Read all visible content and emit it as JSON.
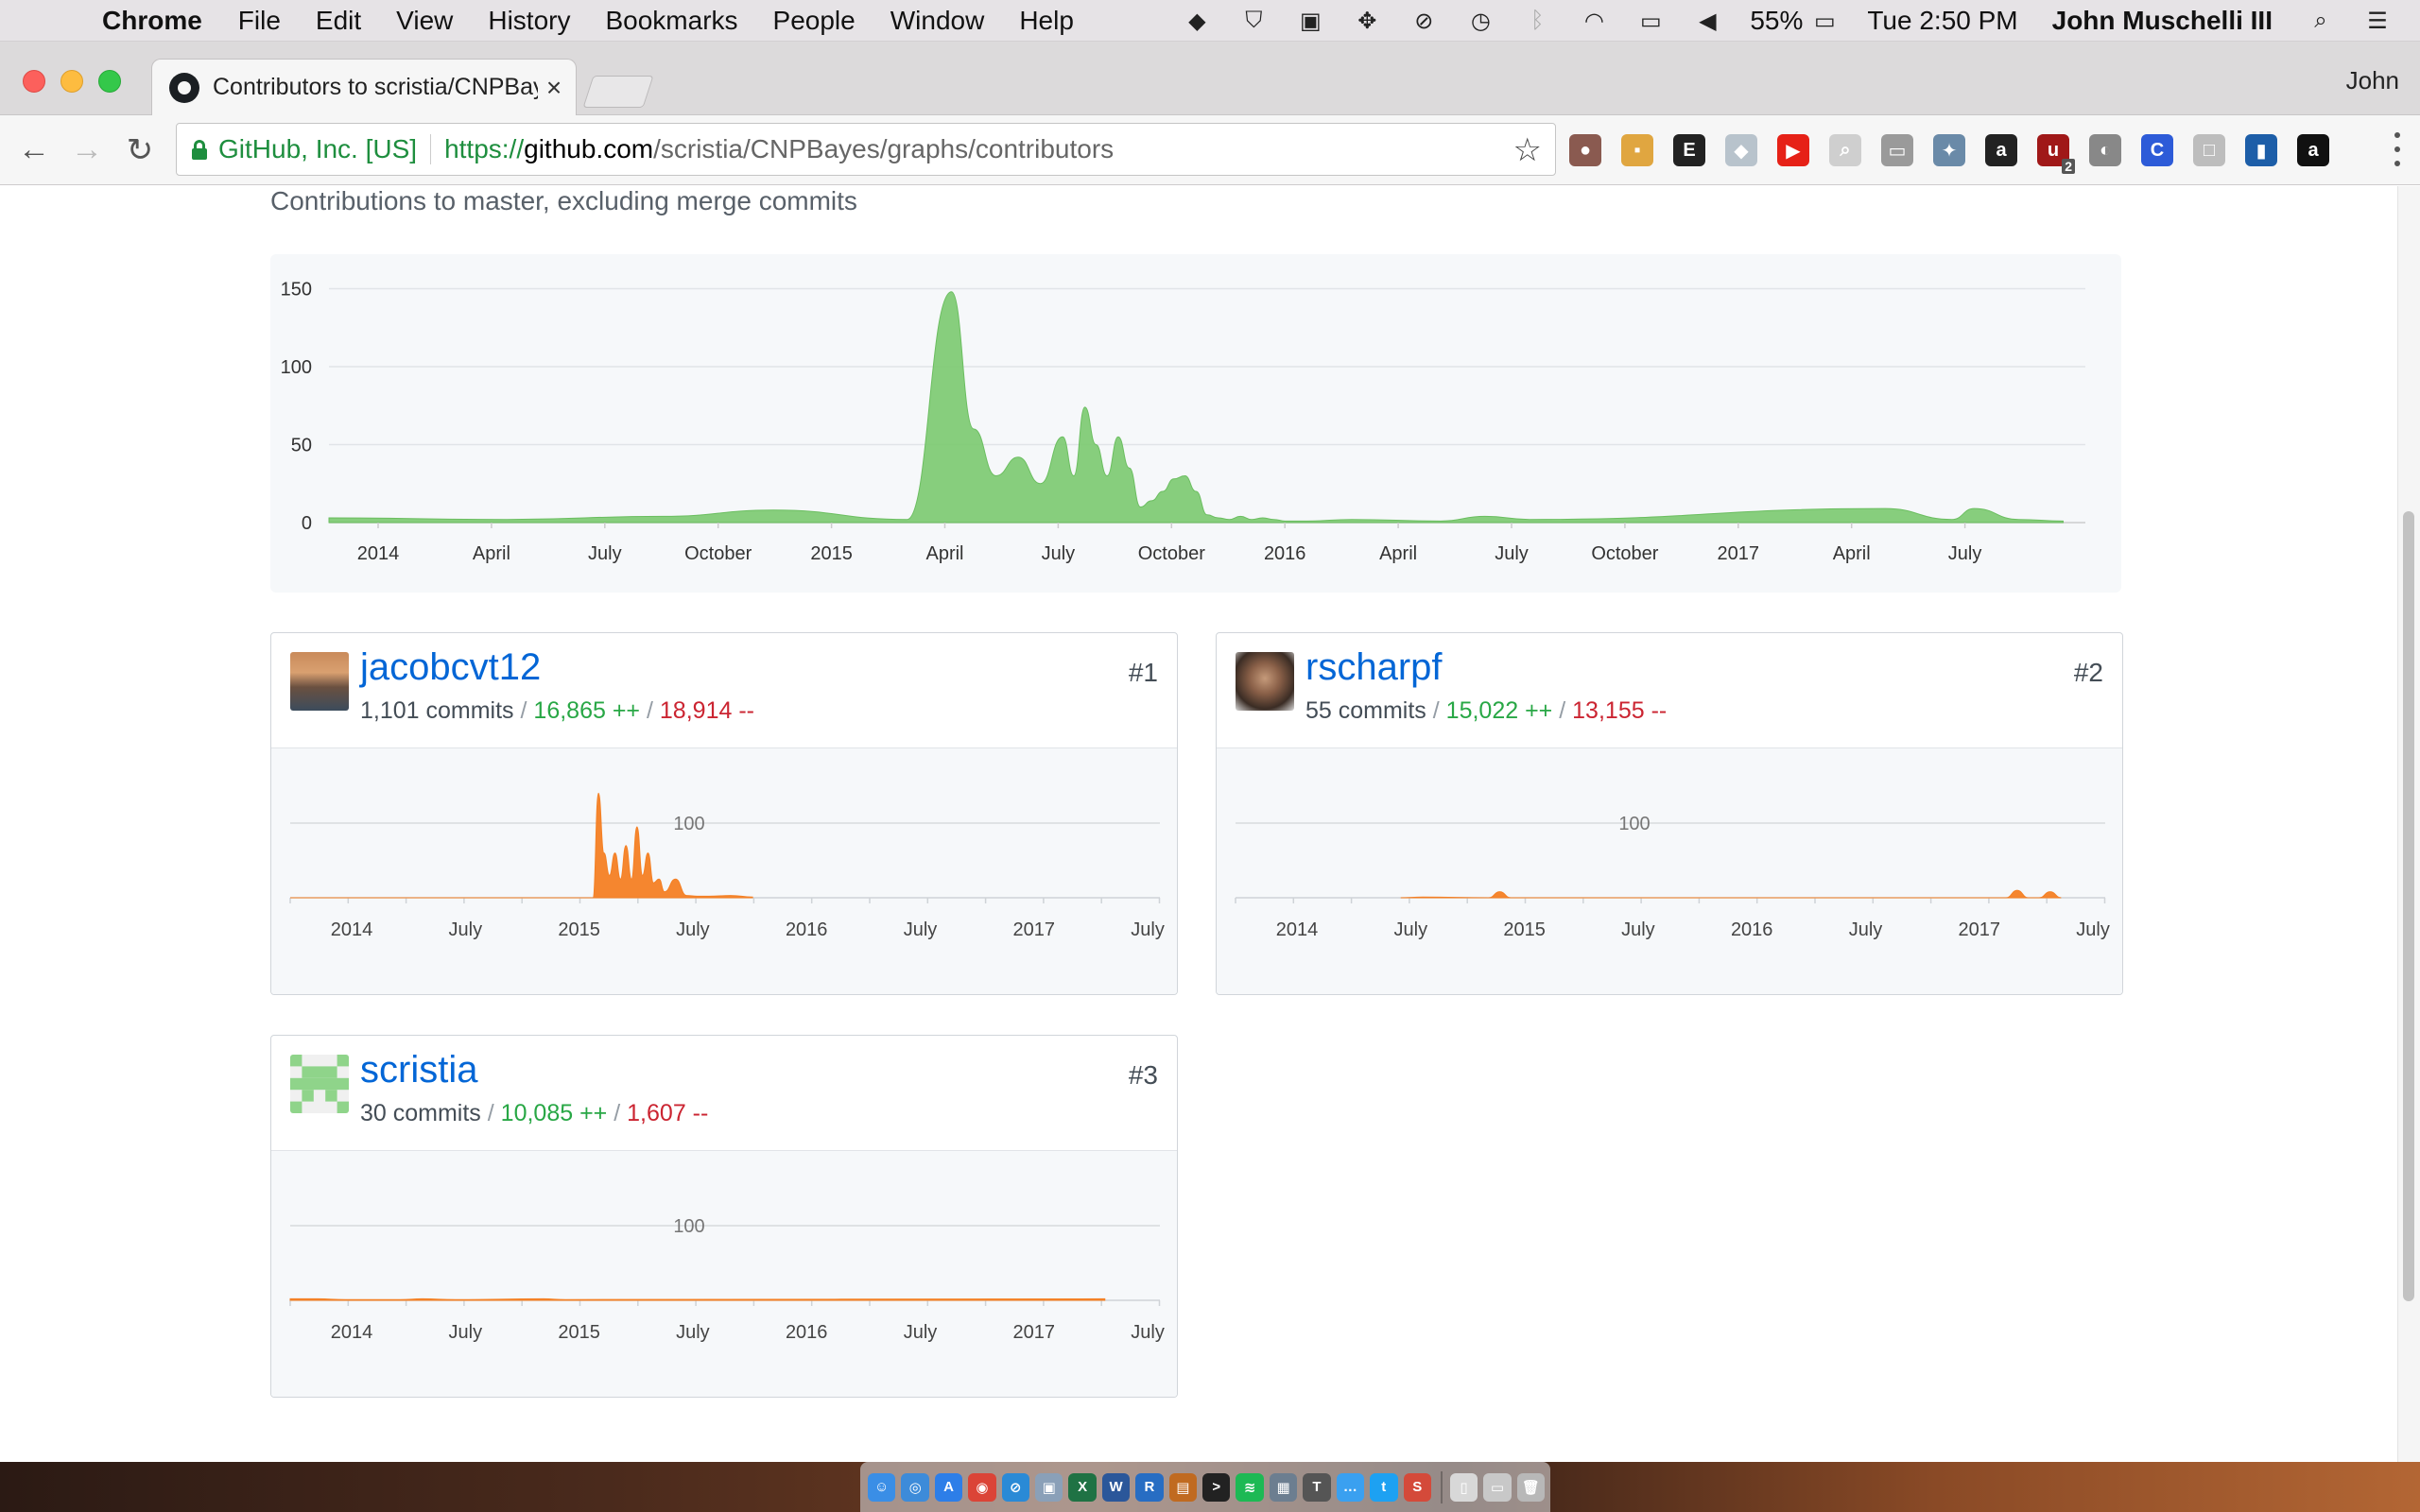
{
  "menubar": {
    "app_name": "Chrome",
    "items": [
      "File",
      "Edit",
      "View",
      "History",
      "Bookmarks",
      "People",
      "Window",
      "Help"
    ],
    "battery": "55%",
    "clock": "Tue 2:50 PM",
    "user": "John Muschelli III",
    "status_icons": [
      "dropbox-icon",
      "shield-icon",
      "evernote-icon",
      "move-icon",
      "sync-icon",
      "time-machine-icon",
      "bluetooth-icon",
      "wifi-icon",
      "airplay-icon",
      "volume-icon",
      "battery-icon"
    ]
  },
  "browser": {
    "tab_title": "Contributors to scristia/CNPBayes",
    "tab_close": "×",
    "profile": "John",
    "omnibox": {
      "ev_name": "GitHub, Inc. [US]",
      "scheme": "https://",
      "host": "github.com",
      "path": "/scristia/CNPBayes/graphs/contributors"
    },
    "extensions": [
      {
        "name": "pomodoro-extension-icon",
        "color": "#8a5a50",
        "glyph": "●"
      },
      {
        "name": "notes-extension-icon",
        "color": "#e0a640",
        "glyph": "▪"
      },
      {
        "name": "evernote-extension-icon",
        "color": "#222222",
        "glyph": "E"
      },
      {
        "name": "dropbox-extension-icon",
        "color": "#b8c3cc",
        "glyph": "◆"
      },
      {
        "name": "youtube-extension-icon",
        "color": "#e62117",
        "glyph": "▶"
      },
      {
        "name": "search-extension-icon",
        "color": "#cfcfcf",
        "glyph": "⌕"
      },
      {
        "name": "cast-extension-icon",
        "color": "#9a9a9a",
        "glyph": "▭"
      },
      {
        "name": "satellite-extension-icon",
        "color": "#6a8aa8",
        "glyph": "✦"
      },
      {
        "name": "amazon-extension-icon",
        "color": "#222222",
        "glyph": "a"
      },
      {
        "name": "ublock-extension-icon",
        "color": "#a01818",
        "glyph": "u",
        "badge": "2"
      },
      {
        "name": "toggle-extension-icon",
        "color": "#888888",
        "glyph": "◐"
      },
      {
        "name": "circle-extension-icon",
        "color": "#2d5bd8",
        "glyph": "C"
      },
      {
        "name": "box-extension-icon",
        "color": "#bdbdbd",
        "glyph": "□"
      },
      {
        "name": "stats-extension-icon",
        "color": "#1d5ea8",
        "glyph": "▮"
      },
      {
        "name": "amazon-assistant-extension-icon",
        "color": "#111111",
        "glyph": "a"
      }
    ]
  },
  "page": {
    "subtitle": "Contributions to master, excluding merge commits"
  },
  "chart_data": [
    {
      "type": "area",
      "yticks": [
        0,
        50,
        100,
        150
      ],
      "ylim": [
        0,
        160
      ],
      "xticks": [
        "2014",
        "April",
        "July",
        "October",
        "2015",
        "April",
        "July",
        "October",
        "2016",
        "April",
        "July",
        "October",
        "2017",
        "April",
        "July"
      ],
      "x_weeks": [
        0,
        16,
        30,
        40,
        52,
        56,
        58,
        60,
        62,
        64,
        66,
        67,
        68,
        69,
        70,
        71,
        72,
        73,
        74,
        75,
        76,
        77,
        78,
        79,
        80,
        81,
        82,
        83,
        84,
        85,
        86,
        88,
        92,
        100,
        104,
        108,
        140,
        146,
        148,
        152,
        156
      ],
      "values": [
        3,
        2,
        4,
        8,
        2,
        148,
        60,
        30,
        42,
        25,
        55,
        30,
        74,
        50,
        30,
        55,
        35,
        10,
        14,
        20,
        28,
        30,
        20,
        5,
        3,
        2,
        4,
        2,
        3,
        2,
        1,
        1,
        2,
        1,
        4,
        2,
        9,
        2,
        9,
        2,
        1
      ],
      "color": "#7bc96f"
    },
    {
      "type": "area",
      "contributor": "jacobcvt12",
      "xticks": [
        "2014",
        "July",
        "2015",
        "July",
        "2016",
        "July",
        "2017",
        "July"
      ],
      "ytick": "100",
      "x_weeks": [
        0,
        55,
        56,
        57,
        58,
        59,
        60,
        61,
        62,
        63,
        64,
        65,
        66,
        67,
        68,
        70,
        72,
        74,
        76,
        80,
        84
      ],
      "values": [
        0,
        0,
        140,
        60,
        30,
        60,
        25,
        70,
        25,
        95,
        30,
        60,
        20,
        25,
        8,
        25,
        3,
        2,
        2,
        3,
        1
      ],
      "color": "#f48024"
    },
    {
      "type": "area",
      "contributor": "rscharpf",
      "xticks": [
        "2014",
        "July",
        "2015",
        "July",
        "2016",
        "July",
        "2017",
        "July"
      ],
      "ytick": "100",
      "x_weeks": [
        30,
        34,
        46,
        48,
        50,
        100,
        140,
        142,
        144,
        146,
        148,
        150
      ],
      "values": [
        0,
        1,
        0,
        8,
        0,
        0,
        0,
        10,
        0,
        0,
        8,
        0
      ],
      "color": "#f48024"
    },
    {
      "type": "area",
      "contributor": "scristia",
      "xticks": [
        "2014",
        "July",
        "2015",
        "July",
        "2016",
        "July",
        "2017",
        "July"
      ],
      "ytick": "100",
      "x_weeks": [
        0,
        5,
        10,
        20,
        24,
        30,
        46,
        50,
        148
      ],
      "values": [
        2,
        2,
        1,
        1,
        2,
        1,
        2,
        1,
        2
      ],
      "color": "#f48024"
    }
  ],
  "contributors": [
    {
      "username": "jacobcvt12",
      "rank": "#1",
      "commits": "1,101 commits",
      "additions": "16,865 ++",
      "deletions": "18,914 --"
    },
    {
      "username": "rscharpf",
      "rank": "#2",
      "commits": "55 commits",
      "additions": "15,022 ++",
      "deletions": "13,155 --"
    },
    {
      "username": "scristia",
      "rank": "#3",
      "commits": "30 commits",
      "additions": "10,085 ++",
      "deletions": "1,607 --"
    }
  ],
  "separator": "/",
  "dock": [
    {
      "name": "finder-dock-icon",
      "color": "#3a8ee6",
      "glyph": "☺"
    },
    {
      "name": "safari-dock-icon",
      "color": "#3d8bd9",
      "glyph": "◎"
    },
    {
      "name": "app-store-dock-icon",
      "color": "#2d7ee8",
      "glyph": "A"
    },
    {
      "name": "chrome-dock-icon",
      "color": "#db4437",
      "glyph": "◉"
    },
    {
      "name": "safari2-dock-icon",
      "color": "#2a8ad6",
      "glyph": "⊘"
    },
    {
      "name": "preview-dock-icon",
      "color": "#8aa0b8",
      "glyph": "▣"
    },
    {
      "name": "excel-dock-icon",
      "color": "#1f7244",
      "glyph": "X"
    },
    {
      "name": "word-dock-icon",
      "color": "#2b579a",
      "glyph": "W"
    },
    {
      "name": "r-dock-icon",
      "color": "#276dc3",
      "glyph": "R"
    },
    {
      "name": "rstudio-dock-icon",
      "color": "#c06a20",
      "glyph": "▤"
    },
    {
      "name": "terminal-dock-icon",
      "color": "#222222",
      "glyph": ">"
    },
    {
      "name": "spotify-dock-icon",
      "color": "#1db954",
      "glyph": "≋"
    },
    {
      "name": "calendar-dock-icon",
      "color": "#6c7e90",
      "glyph": "▦"
    },
    {
      "name": "tex-dock-icon",
      "color": "#555555",
      "glyph": "T"
    },
    {
      "name": "messages-dock-icon",
      "color": "#3aa0f0",
      "glyph": "…"
    },
    {
      "name": "twitter-dock-icon",
      "color": "#1da1f2",
      "glyph": "t"
    },
    {
      "name": "skim-dock-icon",
      "color": "#d44a3a",
      "glyph": "S"
    },
    {
      "name": "documents-dock-icon",
      "color": "#d8d8d8",
      "glyph": "▯"
    },
    {
      "name": "downloads-dock-icon",
      "color": "#c8c8c8",
      "glyph": "▭"
    },
    {
      "name": "trash-dock-icon",
      "color": "#b8b8b8",
      "glyph": "🗑"
    }
  ]
}
